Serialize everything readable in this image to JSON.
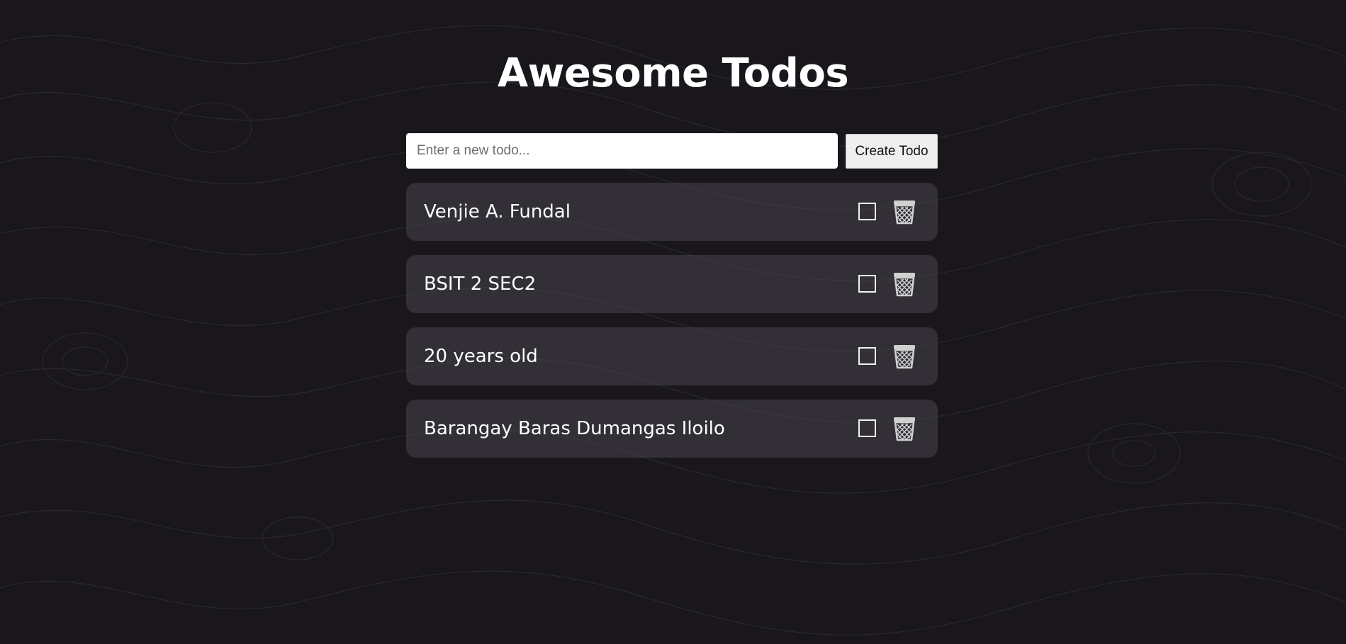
{
  "app": {
    "title": "Awesome Todos"
  },
  "form": {
    "input_value": "",
    "input_placeholder": "Enter a new todo...",
    "create_label": "Create Todo"
  },
  "todos": [
    {
      "text": "Venjie A. Fundal",
      "completed": false,
      "delete_icon": "trash-bin-icon"
    },
    {
      "text": "BSIT 2 SEC2",
      "completed": false,
      "delete_icon": "trash-bin-icon"
    },
    {
      "text": "20 years old",
      "completed": false,
      "delete_icon": "trash-bin-icon"
    },
    {
      "text": "Barangay Baras Dumangas Iloilo",
      "completed": false,
      "delete_icon": "trash-bin-icon"
    }
  ],
  "colors": {
    "background": "#19161c",
    "card": "#3a383f",
    "text": "#ffffff",
    "icon": "#d0d0d0"
  }
}
